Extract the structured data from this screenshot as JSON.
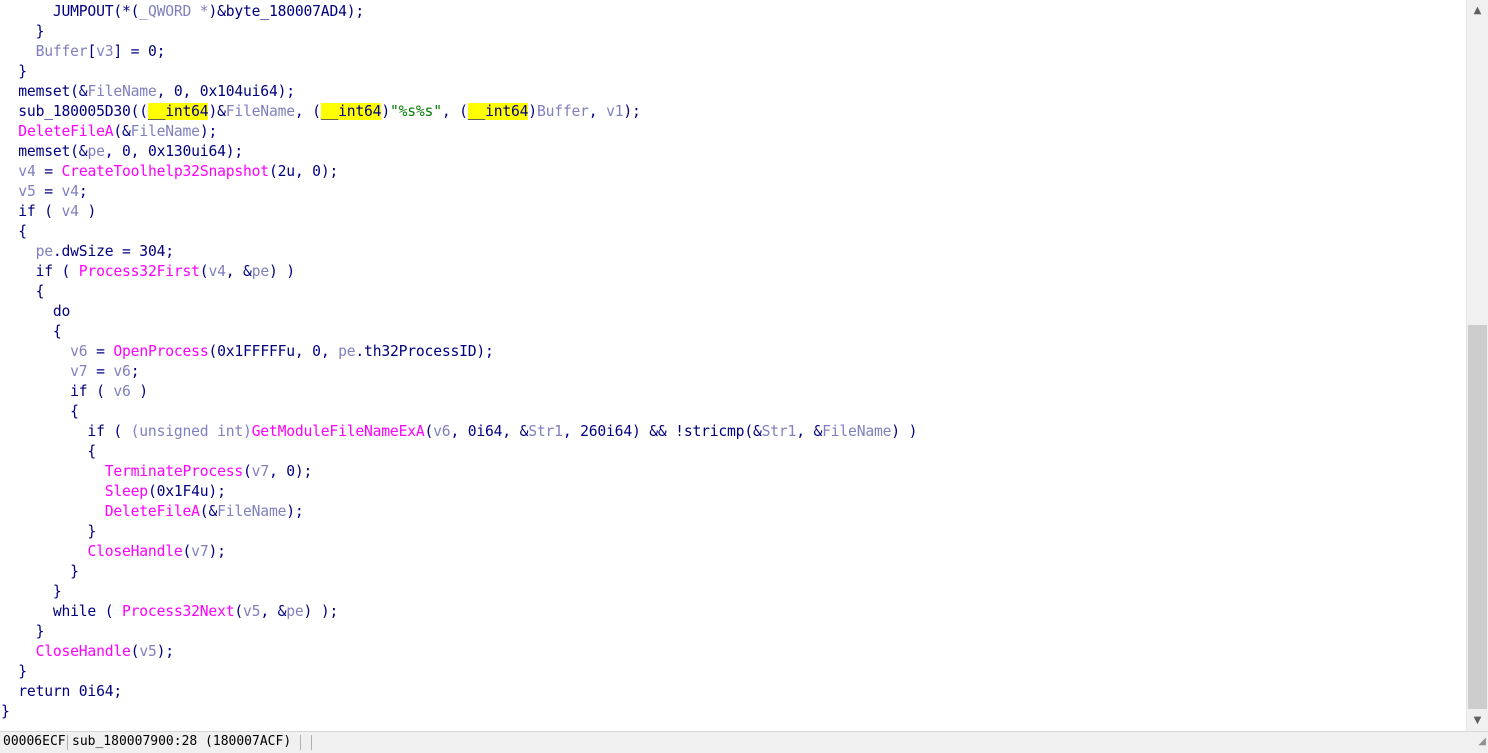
{
  "code_lines": [
    [
      {
        "t": "      JUMPOUT(*("
      },
      {
        "t": "_QWORD *",
        "c": "var"
      },
      {
        "t": ")&byte_180007AD4);"
      }
    ],
    [
      {
        "t": "    }"
      }
    ],
    [
      {
        "t": "    "
      },
      {
        "t": "Buffer",
        "c": "var"
      },
      {
        "t": "["
      },
      {
        "t": "v3",
        "c": "var"
      },
      {
        "t": "] = 0;"
      }
    ],
    [
      {
        "t": "  }"
      }
    ],
    [
      {
        "t": "  memset(&"
      },
      {
        "t": "FileName",
        "c": "var"
      },
      {
        "t": ", 0, 0x104ui64);"
      }
    ],
    [
      {
        "t": "  sub_180005D30(("
      },
      {
        "t": "__int64",
        "c": "hl"
      },
      {
        "t": ")&"
      },
      {
        "t": "FileName",
        "c": "var"
      },
      {
        "t": ", ("
      },
      {
        "t": "__int64",
        "c": "hl"
      },
      {
        "t": ")"
      },
      {
        "t": "\"%s%s\"",
        "c": "str"
      },
      {
        "t": ", ("
      },
      {
        "t": "__int64",
        "c": "hl"
      },
      {
        "t": ")"
      },
      {
        "t": "Buffer",
        "c": "var"
      },
      {
        "t": ", "
      },
      {
        "t": "v1",
        "c": "var"
      },
      {
        "t": ");"
      }
    ],
    [
      {
        "t": "  "
      },
      {
        "t": "DeleteFileA",
        "c": "fn"
      },
      {
        "t": "(&"
      },
      {
        "t": "FileName",
        "c": "var"
      },
      {
        "t": ");"
      }
    ],
    [
      {
        "t": "  memset(&"
      },
      {
        "t": "pe",
        "c": "var"
      },
      {
        "t": ", 0, 0x130ui64);"
      }
    ],
    [
      {
        "t": "  "
      },
      {
        "t": "v4",
        "c": "var"
      },
      {
        "t": " = "
      },
      {
        "t": "CreateToolhelp32Snapshot",
        "c": "fn"
      },
      {
        "t": "(2u, 0);"
      }
    ],
    [
      {
        "t": "  "
      },
      {
        "t": "v5",
        "c": "var"
      },
      {
        "t": " = "
      },
      {
        "t": "v4",
        "c": "var"
      },
      {
        "t": ";"
      }
    ],
    [
      {
        "t": "  if ( "
      },
      {
        "t": "v4",
        "c": "var"
      },
      {
        "t": " )"
      }
    ],
    [
      {
        "t": "  {"
      }
    ],
    [
      {
        "t": "    "
      },
      {
        "t": "pe",
        "c": "var"
      },
      {
        "t": ".dwSize = 304;"
      }
    ],
    [
      {
        "t": "    if ( "
      },
      {
        "t": "Process32First",
        "c": "fn"
      },
      {
        "t": "("
      },
      {
        "t": "v4",
        "c": "var"
      },
      {
        "t": ", &"
      },
      {
        "t": "pe",
        "c": "var"
      },
      {
        "t": ") )"
      }
    ],
    [
      {
        "t": "    {"
      }
    ],
    [
      {
        "t": "      do"
      }
    ],
    [
      {
        "t": "      {"
      }
    ],
    [
      {
        "t": "        "
      },
      {
        "t": "v6",
        "c": "var"
      },
      {
        "t": " = "
      },
      {
        "t": "OpenProcess",
        "c": "fn"
      },
      {
        "t": "(0x1FFFFFu, 0, "
      },
      {
        "t": "pe",
        "c": "var"
      },
      {
        "t": ".th32ProcessID);"
      }
    ],
    [
      {
        "t": "        "
      },
      {
        "t": "v7",
        "c": "var"
      },
      {
        "t": " = "
      },
      {
        "t": "v6",
        "c": "var"
      },
      {
        "t": ";"
      }
    ],
    [
      {
        "t": "        if ( "
      },
      {
        "t": "v6",
        "c": "var"
      },
      {
        "t": " )"
      }
    ],
    [
      {
        "t": "        {"
      }
    ],
    [
      {
        "t": "          if ( "
      },
      {
        "t": "(unsigned int)",
        "c": "var"
      },
      {
        "t": "GetModuleFileNameExA",
        "c": "fn"
      },
      {
        "t": "("
      },
      {
        "t": "v6",
        "c": "var"
      },
      {
        "t": ", 0i64, &"
      },
      {
        "t": "Str1",
        "c": "var"
      },
      {
        "t": ", 260i64) && !stricmp(&"
      },
      {
        "t": "Str1",
        "c": "var"
      },
      {
        "t": ", &"
      },
      {
        "t": "FileName",
        "c": "var"
      },
      {
        "t": ") )"
      }
    ],
    [
      {
        "t": "          {"
      }
    ],
    [
      {
        "t": "            "
      },
      {
        "t": "TerminateProcess",
        "c": "fn"
      },
      {
        "t": "("
      },
      {
        "t": "v7",
        "c": "var"
      },
      {
        "t": ", 0);"
      }
    ],
    [
      {
        "t": "            "
      },
      {
        "t": "Sleep",
        "c": "fn"
      },
      {
        "t": "(0x1F4u);"
      }
    ],
    [
      {
        "t": "            "
      },
      {
        "t": "DeleteFileA",
        "c": "fn"
      },
      {
        "t": "(&"
      },
      {
        "t": "FileName",
        "c": "var"
      },
      {
        "t": ");"
      }
    ],
    [
      {
        "t": "          }"
      }
    ],
    [
      {
        "t": "          "
      },
      {
        "t": "CloseHandle",
        "c": "fn"
      },
      {
        "t": "("
      },
      {
        "t": "v7",
        "c": "var"
      },
      {
        "t": ");"
      }
    ],
    [
      {
        "t": "        }"
      }
    ],
    [
      {
        "t": "      }"
      }
    ],
    [
      {
        "t": "      while ( "
      },
      {
        "t": "Process32Next",
        "c": "fn"
      },
      {
        "t": "("
      },
      {
        "t": "v5",
        "c": "var"
      },
      {
        "t": ", &"
      },
      {
        "t": "pe",
        "c": "var"
      },
      {
        "t": ") );"
      }
    ],
    [
      {
        "t": "    }"
      }
    ],
    [
      {
        "t": "    "
      },
      {
        "t": "CloseHandle",
        "c": "fn"
      },
      {
        "t": "("
      },
      {
        "t": "v5",
        "c": "var"
      },
      {
        "t": ");"
      }
    ],
    [
      {
        "t": "  }"
      }
    ],
    [
      {
        "t": "  return 0i64;"
      }
    ],
    [
      {
        "t": "}"
      }
    ]
  ],
  "statusbar": {
    "address": "00006ECF",
    "location": "sub_180007900:28 (180007ACF)"
  },
  "scrollbar": {
    "up_glyph": "▲",
    "down_glyph": "▼",
    "position_fraction": 0.45
  },
  "colors": {
    "code_text": "#000080",
    "function_name": "#ff00ff",
    "variable": "#8080c0",
    "string_literal": "#008000",
    "highlight_bg": "#ffff00"
  }
}
